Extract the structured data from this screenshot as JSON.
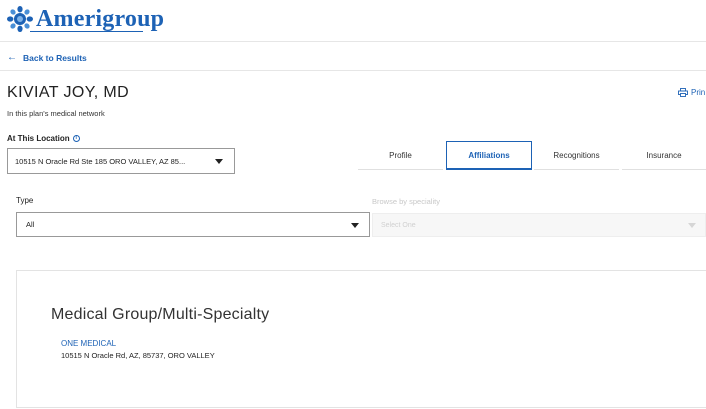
{
  "brand": {
    "name": "Amerigroup",
    "color": "#1d62b5",
    "logo_icon": "sunburst-logo-icon"
  },
  "nav": {
    "back_label": "Back to Results",
    "back_icon": "left-arrow-icon"
  },
  "provider": {
    "name": "KIVIAT JOY, MD",
    "network_note": "In this plan's medical network"
  },
  "actions": {
    "print_label": "Prin",
    "print_icon": "printer-icon"
  },
  "location": {
    "label": "At This Location",
    "info_icon": "info-icon",
    "selected": "10515 N Oracle Rd Ste 185 ORO VALLEY, AZ 85..."
  },
  "tabs": [
    {
      "label": "Profile",
      "active": false
    },
    {
      "label": "Affiliations",
      "active": true
    },
    {
      "label": "Recognitions",
      "active": false
    },
    {
      "label": "Insurance",
      "active": false
    }
  ],
  "filters": {
    "type_label": "Type",
    "type_value": "All",
    "specialty_label": "Browse by speciality",
    "specialty_placeholder": "Select One"
  },
  "affiliation": {
    "heading": "Medical Group/Multi-Specialty",
    "org_name": "ONE MEDICAL",
    "address": "10515 N Oracle Rd, AZ, 85737, ORO VALLEY"
  }
}
